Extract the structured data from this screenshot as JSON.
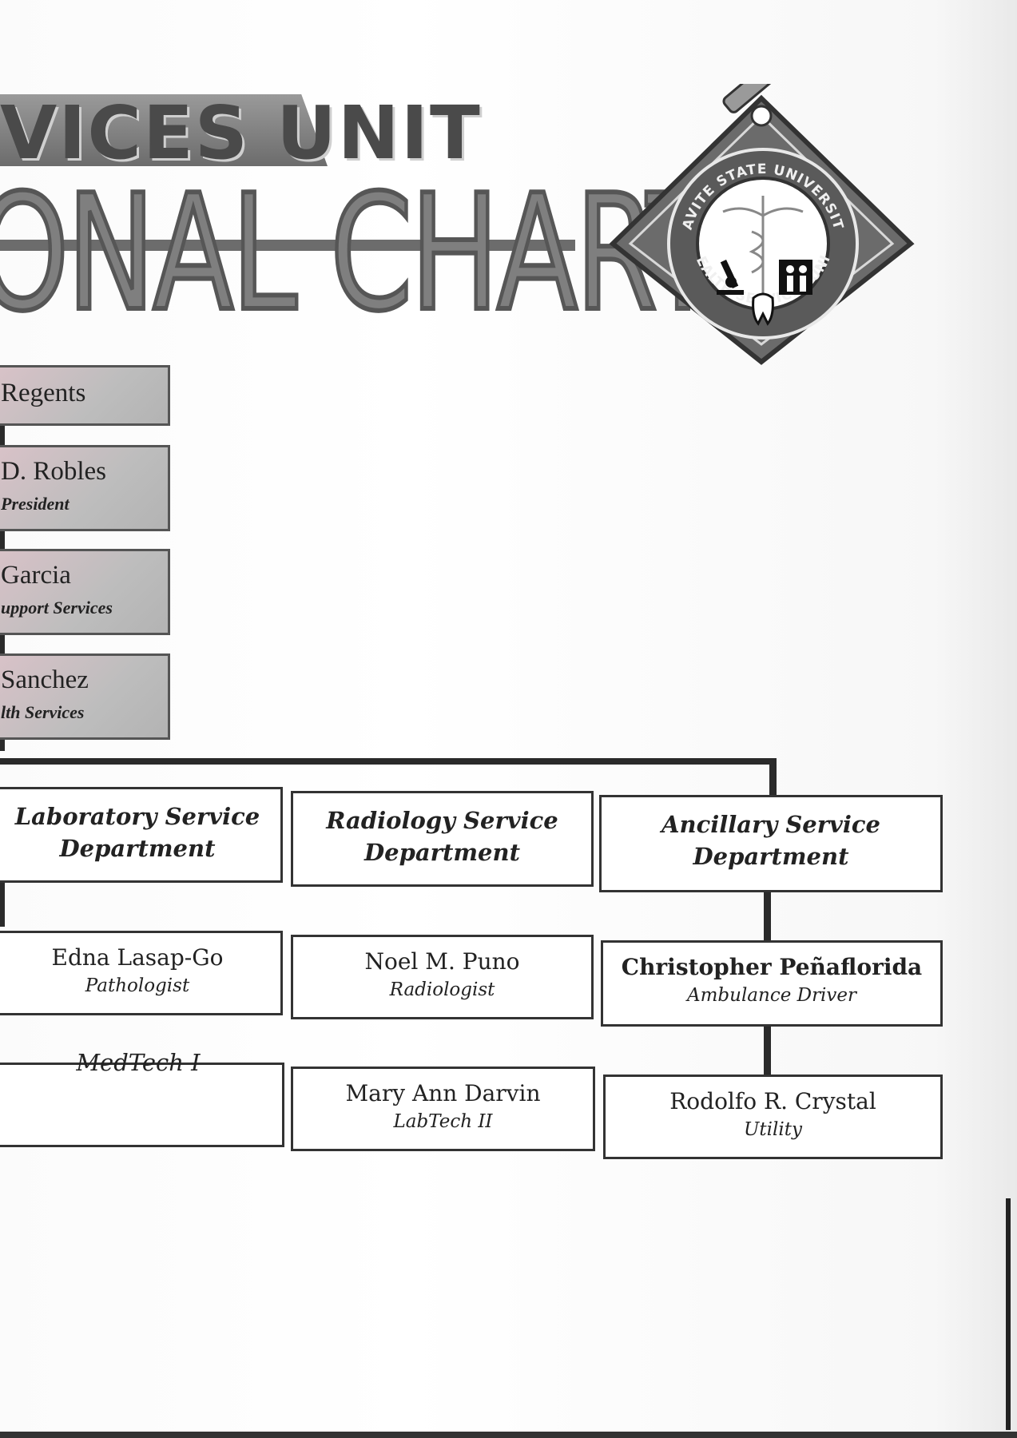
{
  "banner": {
    "line1": "VICES UNIT",
    "line2": "ONAL CHART"
  },
  "emblem": {
    "ring_top": "CAVITE STATE UNIVERSITY",
    "ring_bottom": "HEALTH SERVICES UNIT"
  },
  "hierarchy": [
    {
      "name": "Regents",
      "role": ""
    },
    {
      "name": "D. Robles",
      "role": "President"
    },
    {
      "name": "Garcia",
      "role": "upport Services"
    },
    {
      "name": "Sanchez",
      "role": "lth Services"
    }
  ],
  "departments": [
    {
      "line1": "Laboratory Service",
      "line2": "Department"
    },
    {
      "line1": "Radiology Service",
      "line2": "Department"
    },
    {
      "line1": "Ancillary Service",
      "line2": "Department"
    }
  ],
  "staff": {
    "row1": [
      {
        "name": "Edna Lasap-Go",
        "role": "Pathologist"
      },
      {
        "name": "Noel M. Puno",
        "role": "Radiologist"
      },
      {
        "name": "Christopher Peñaflorida",
        "role": "Ambulance Driver"
      }
    ],
    "row2": [
      {
        "name": "",
        "role": "MedTech I"
      },
      {
        "name": "Mary Ann Darvin",
        "role": "LabTech II"
      },
      {
        "name": "Rodolfo R. Crystal",
        "role": "Utility"
      }
    ]
  }
}
